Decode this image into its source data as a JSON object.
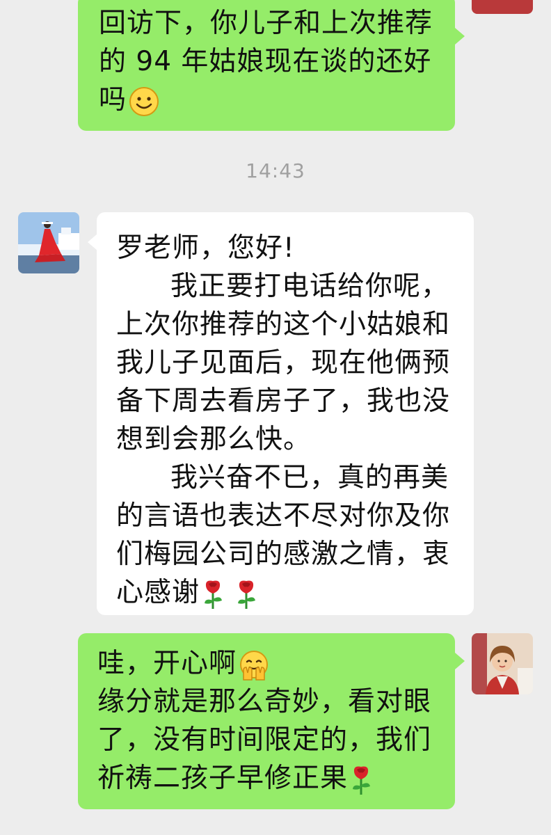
{
  "messages": [
    {
      "sender": "me",
      "lines": [
        "回访下，你儿子和上次推荐",
        "的 94 年姑娘现在谈的还好",
        "吗"
      ],
      "emoji": [
        "smile-icon"
      ]
    },
    {
      "sender": "other",
      "lines": [
        "罗老师，您好!",
        "我正要打电话给你呢，",
        "上次你推荐的这个小姑娘和",
        "我儿子见面后，现在他俩预",
        "备下周去看房子了，我也没",
        "想到会那么快。",
        "我兴奋不已，真的再美",
        "的言语也表达不尽对你及你",
        "们梅园公司的感激之情，衷",
        "心感谢"
      ],
      "emoji": [
        "rose-icon",
        "rose-icon"
      ]
    },
    {
      "sender": "me",
      "lines": [
        "哇，开心啊",
        "缘分就是那么奇妙，看对眼",
        "了，没有时间限定的，我们",
        "祈祷二孩子早修正果"
      ],
      "emoji": [
        "facepalm-icon",
        "rose-icon"
      ]
    }
  ],
  "timestamp": "14:43",
  "colors": {
    "background": "#ededed",
    "my_bubble": "#95ec69",
    "their_bubble": "#ffffff",
    "timestamp_text": "#a0a0a0"
  }
}
